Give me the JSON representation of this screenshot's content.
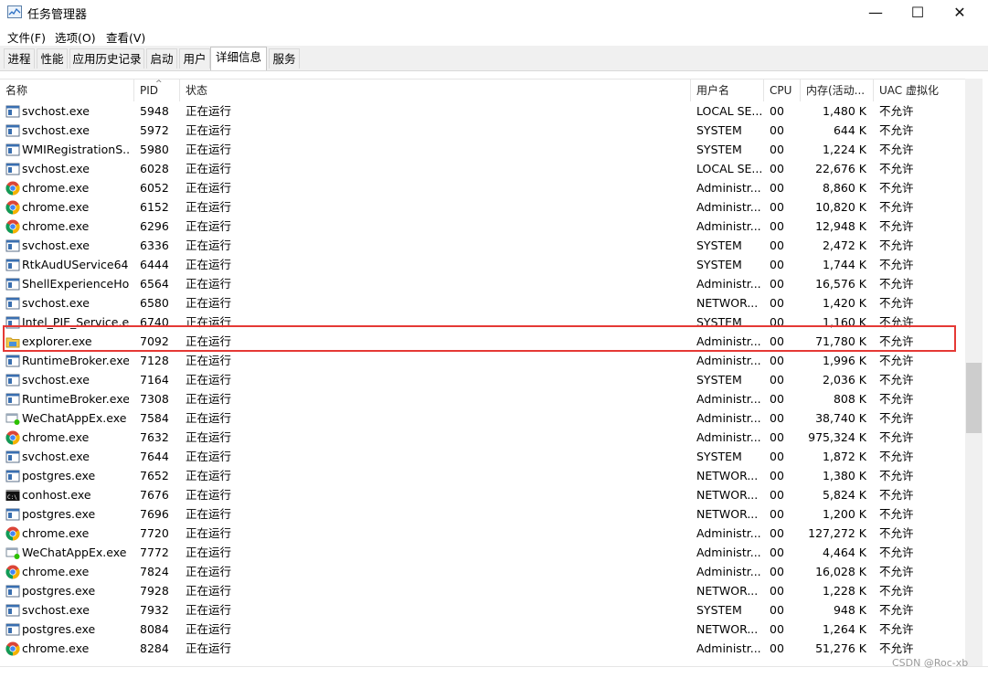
{
  "window": {
    "title": "任务管理器",
    "minimize": "—",
    "maximize": "☐",
    "close": "✕"
  },
  "menu": [
    "文件(F)",
    "选项(O)",
    "查看(V)"
  ],
  "tabs": [
    {
      "label": "进程",
      "active": false
    },
    {
      "label": "性能",
      "active": false
    },
    {
      "label": "应用历史记录",
      "active": false
    },
    {
      "label": "启动",
      "active": false
    },
    {
      "label": "用户",
      "active": false
    },
    {
      "label": "详细信息",
      "active": true
    },
    {
      "label": "服务",
      "active": false
    }
  ],
  "columns": [
    "名称",
    "PID",
    "状态",
    "用户名",
    "CPU",
    "内存(活动...",
    "UAC 虚拟化"
  ],
  "rows": [
    {
      "name": "svchost.exe",
      "pid": "5948",
      "status": "正在运行",
      "user": "LOCAL SE...",
      "cpu": "00",
      "mem": "1,480 K",
      "uac": "不允许",
      "icon": "svc"
    },
    {
      "name": "svchost.exe",
      "pid": "5972",
      "status": "正在运行",
      "user": "SYSTEM",
      "cpu": "00",
      "mem": "644 K",
      "uac": "不允许",
      "icon": "svc"
    },
    {
      "name": "WMIRegistrationS...",
      "pid": "5980",
      "status": "正在运行",
      "user": "SYSTEM",
      "cpu": "00",
      "mem": "1,224 K",
      "uac": "不允许",
      "icon": "svc"
    },
    {
      "name": "svchost.exe",
      "pid": "6028",
      "status": "正在运行",
      "user": "LOCAL SE...",
      "cpu": "00",
      "mem": "22,676 K",
      "uac": "不允许",
      "icon": "svc"
    },
    {
      "name": "chrome.exe",
      "pid": "6052",
      "status": "正在运行",
      "user": "Administr...",
      "cpu": "00",
      "mem": "8,860 K",
      "uac": "不允许",
      "icon": "chrome"
    },
    {
      "name": "chrome.exe",
      "pid": "6152",
      "status": "正在运行",
      "user": "Administr...",
      "cpu": "00",
      "mem": "10,820 K",
      "uac": "不允许",
      "icon": "chrome"
    },
    {
      "name": "chrome.exe",
      "pid": "6296",
      "status": "正在运行",
      "user": "Administr...",
      "cpu": "00",
      "mem": "12,948 K",
      "uac": "不允许",
      "icon": "chrome"
    },
    {
      "name": "svchost.exe",
      "pid": "6336",
      "status": "正在运行",
      "user": "SYSTEM",
      "cpu": "00",
      "mem": "2,472 K",
      "uac": "不允许",
      "icon": "svc"
    },
    {
      "name": "RtkAudUService64....",
      "pid": "6444",
      "status": "正在运行",
      "user": "SYSTEM",
      "cpu": "00",
      "mem": "1,744 K",
      "uac": "不允许",
      "icon": "svc"
    },
    {
      "name": "ShellExperienceHo...",
      "pid": "6564",
      "status": "正在运行",
      "user": "Administr...",
      "cpu": "00",
      "mem": "16,576 K",
      "uac": "不允许",
      "icon": "svc"
    },
    {
      "name": "svchost.exe",
      "pid": "6580",
      "status": "正在运行",
      "user": "NETWOR...",
      "cpu": "00",
      "mem": "1,420 K",
      "uac": "不允许",
      "icon": "svc"
    },
    {
      "name": "Intel_PIE_Service.exe",
      "pid": "6740",
      "status": "正在运行",
      "user": "SYSTEM",
      "cpu": "00",
      "mem": "1,160 K",
      "uac": "不允许",
      "icon": "svc"
    },
    {
      "name": "explorer.exe",
      "pid": "7092",
      "status": "正在运行",
      "user": "Administr...",
      "cpu": "00",
      "mem": "71,780 K",
      "uac": "不允许",
      "icon": "folder"
    },
    {
      "name": "RuntimeBroker.exe",
      "pid": "7128",
      "status": "正在运行",
      "user": "Administr...",
      "cpu": "00",
      "mem": "1,996 K",
      "uac": "不允许",
      "icon": "svc"
    },
    {
      "name": "svchost.exe",
      "pid": "7164",
      "status": "正在运行",
      "user": "SYSTEM",
      "cpu": "00",
      "mem": "2,036 K",
      "uac": "不允许",
      "icon": "svc"
    },
    {
      "name": "RuntimeBroker.exe",
      "pid": "7308",
      "status": "正在运行",
      "user": "Administr...",
      "cpu": "00",
      "mem": "808 K",
      "uac": "不允许",
      "icon": "svc"
    },
    {
      "name": "WeChatAppEx.exe",
      "pid": "7584",
      "status": "正在运行",
      "user": "Administr...",
      "cpu": "00",
      "mem": "38,740 K",
      "uac": "不允许",
      "icon": "wechat"
    },
    {
      "name": "chrome.exe",
      "pid": "7632",
      "status": "正在运行",
      "user": "Administr...",
      "cpu": "00",
      "mem": "975,324 K",
      "uac": "不允许",
      "icon": "chrome"
    },
    {
      "name": "svchost.exe",
      "pid": "7644",
      "status": "正在运行",
      "user": "SYSTEM",
      "cpu": "00",
      "mem": "1,872 K",
      "uac": "不允许",
      "icon": "svc"
    },
    {
      "name": "postgres.exe",
      "pid": "7652",
      "status": "正在运行",
      "user": "NETWOR...",
      "cpu": "00",
      "mem": "1,380 K",
      "uac": "不允许",
      "icon": "svc"
    },
    {
      "name": "conhost.exe",
      "pid": "7676",
      "status": "正在运行",
      "user": "NETWOR...",
      "cpu": "00",
      "mem": "5,824 K",
      "uac": "不允许",
      "icon": "console"
    },
    {
      "name": "postgres.exe",
      "pid": "7696",
      "status": "正在运行",
      "user": "NETWOR...",
      "cpu": "00",
      "mem": "1,200 K",
      "uac": "不允许",
      "icon": "svc"
    },
    {
      "name": "chrome.exe",
      "pid": "7720",
      "status": "正在运行",
      "user": "Administr...",
      "cpu": "00",
      "mem": "127,272 K",
      "uac": "不允许",
      "icon": "chrome"
    },
    {
      "name": "WeChatAppEx.exe",
      "pid": "7772",
      "status": "正在运行",
      "user": "Administr...",
      "cpu": "00",
      "mem": "4,464 K",
      "uac": "不允许",
      "icon": "wechat"
    },
    {
      "name": "chrome.exe",
      "pid": "7824",
      "status": "正在运行",
      "user": "Administr...",
      "cpu": "00",
      "mem": "16,028 K",
      "uac": "不允许",
      "icon": "chrome"
    },
    {
      "name": "postgres.exe",
      "pid": "7928",
      "status": "正在运行",
      "user": "NETWOR...",
      "cpu": "00",
      "mem": "1,228 K",
      "uac": "不允许",
      "icon": "svc"
    },
    {
      "name": "svchost.exe",
      "pid": "7932",
      "status": "正在运行",
      "user": "SYSTEM",
      "cpu": "00",
      "mem": "948 K",
      "uac": "不允许",
      "icon": "svc"
    },
    {
      "name": "postgres.exe",
      "pid": "8084",
      "status": "正在运行",
      "user": "NETWOR...",
      "cpu": "00",
      "mem": "1,264 K",
      "uac": "不允许",
      "icon": "svc"
    },
    {
      "name": "chrome.exe",
      "pid": "8284",
      "status": "正在运行",
      "user": "Administr...",
      "cpu": "00",
      "mem": "51,276 K",
      "uac": "不允许",
      "icon": "chrome"
    }
  ],
  "scrollbar": {
    "position": 0.55,
    "visible_fraction": 0.12
  },
  "watermark": "CSDN @Roc-xb",
  "colors": {
    "highlight": "#e53935",
    "chrome_red": "#db4437",
    "chrome_green": "#0f9d58",
    "chrome_yellow": "#f4b400",
    "chrome_blue": "#4285f4"
  }
}
